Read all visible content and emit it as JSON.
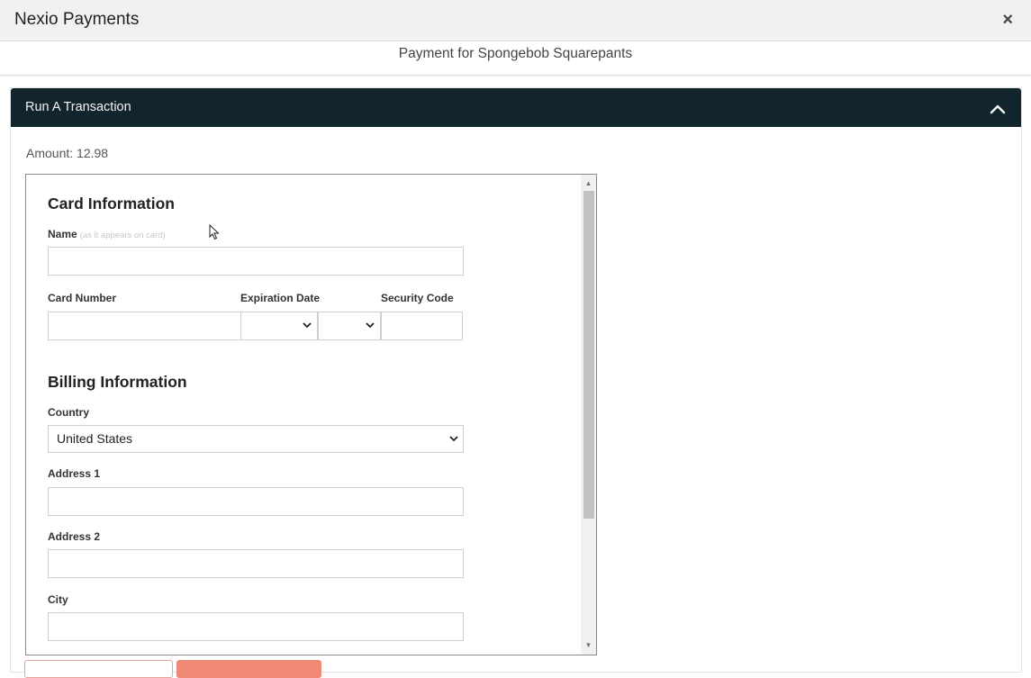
{
  "window": {
    "title": "Nexio Payments",
    "close_label": "×"
  },
  "subheader": {
    "title": "Payment for Spongebob Squarepants"
  },
  "panel": {
    "title": "Run A Transaction",
    "amount": "Amount: 12.98"
  },
  "card_info": {
    "heading": "Card Information",
    "name_label": "Name",
    "name_hint": "(as it appears on card)",
    "name_value": "",
    "card_number_label": "Card Number",
    "card_number_value": "",
    "expiration_label": "Expiration Date",
    "exp_month_value": "",
    "exp_year_value": "",
    "security_code_label": "Security Code",
    "security_code_value": ""
  },
  "billing_info": {
    "heading": "Billing Information",
    "country_label": "Country",
    "country_value": "United States",
    "address1_label": "Address 1",
    "address1_value": "",
    "address2_label": "Address 2",
    "address2_value": "",
    "city_label": "City",
    "city_value": ""
  },
  "icons": {
    "close": "close-icon",
    "collapse": "chevron-up-icon",
    "dropdown": "chevron-down-icon",
    "cursor": "mouse-cursor-icon"
  },
  "colors": {
    "panel_header_bg": "#13252c",
    "primary_button": "#f08a76"
  }
}
